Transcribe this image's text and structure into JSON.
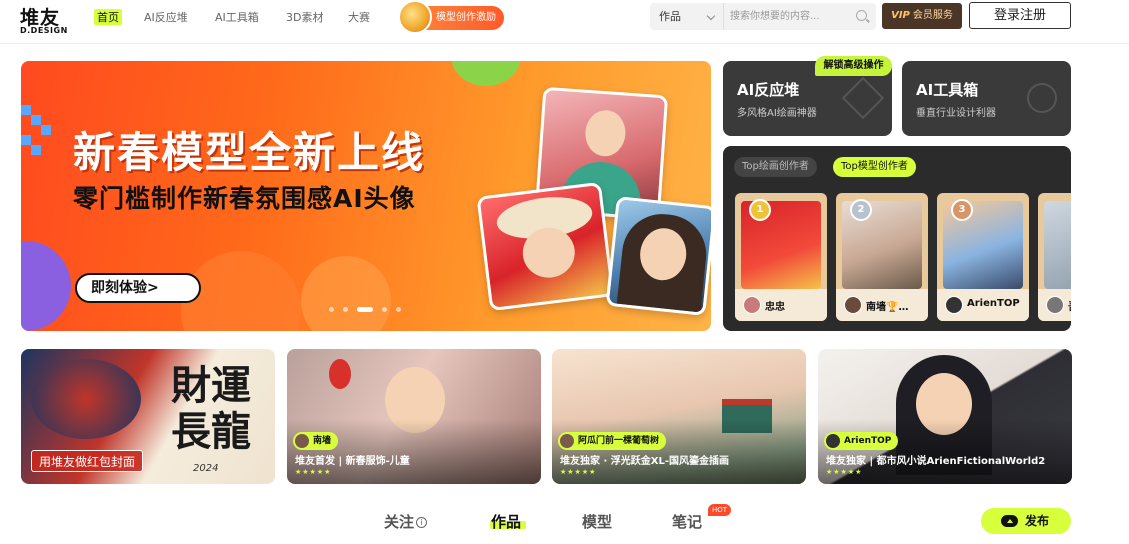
{
  "header": {
    "logo_main": "堆友",
    "logo_sub": "D.DESIGN",
    "nav": [
      "首页",
      "AI反应堆",
      "AI工具箱",
      "3D素材",
      "大赛"
    ],
    "reward_label": "模型创作激励",
    "search": {
      "category": "作品",
      "placeholder": "搜索你想要的内容..."
    },
    "vip": {
      "mark": "VIP",
      "label": "会员服务"
    },
    "login_label": "登录注册"
  },
  "banner": {
    "title": "新春模型全新上线",
    "subtitle": "零门槛制作新春氛围感AI头像",
    "cta": "即刻体验>",
    "slide_count": 5,
    "active_slide": 3
  },
  "tools": [
    {
      "title": "AI反应堆",
      "desc": "多风格AI绘画神器",
      "badge": "解锁高级操作"
    },
    {
      "title": "AI工具箱",
      "desc": "垂直行业设计利器"
    }
  ],
  "creators": {
    "tabs": [
      "Top绘画创作者",
      "Top模型创作者"
    ],
    "active_tab": 1,
    "list": [
      {
        "rank": "1",
        "name": "忠忠",
        "medal_color": "#f0c23a"
      },
      {
        "rank": "2",
        "name": "南墙🏆…",
        "medal_color": "#b8c2cc"
      },
      {
        "rank": "3",
        "name": "ArienTOP",
        "medal_color": "#d8956a"
      },
      {
        "rank": "",
        "name": "吾吃"
      }
    ]
  },
  "cards": [
    {
      "title_art": "財運長龍",
      "year": "2024",
      "tag": "用堆友做红包封面"
    },
    {
      "author": "南墙",
      "caption": "堆友首发 | 新春服饰-儿童",
      "stars": "★★★★★"
    },
    {
      "author": "阿瓜门前一棵葡萄树",
      "caption": "堆友独家 · 浮光跃金XL-国风鎏金插画",
      "stars": "★★★★★"
    },
    {
      "author": "ArienTOP",
      "caption": "堆友独家 | 都市风小说ArienFictionalWorld2",
      "stars": "★★★★★"
    }
  ],
  "bottom_tabs": [
    {
      "label": "关注",
      "info": "i"
    },
    {
      "label": "作品"
    },
    {
      "label": "模型"
    },
    {
      "label": "笔记",
      "badge": "HOT"
    }
  ],
  "active_bottom_tab": 1,
  "publish_label": "发布",
  "colors": {
    "accent": "#d8ff3c",
    "banner": "#ff5a1f",
    "dark_panel": "#2b2b2b"
  }
}
